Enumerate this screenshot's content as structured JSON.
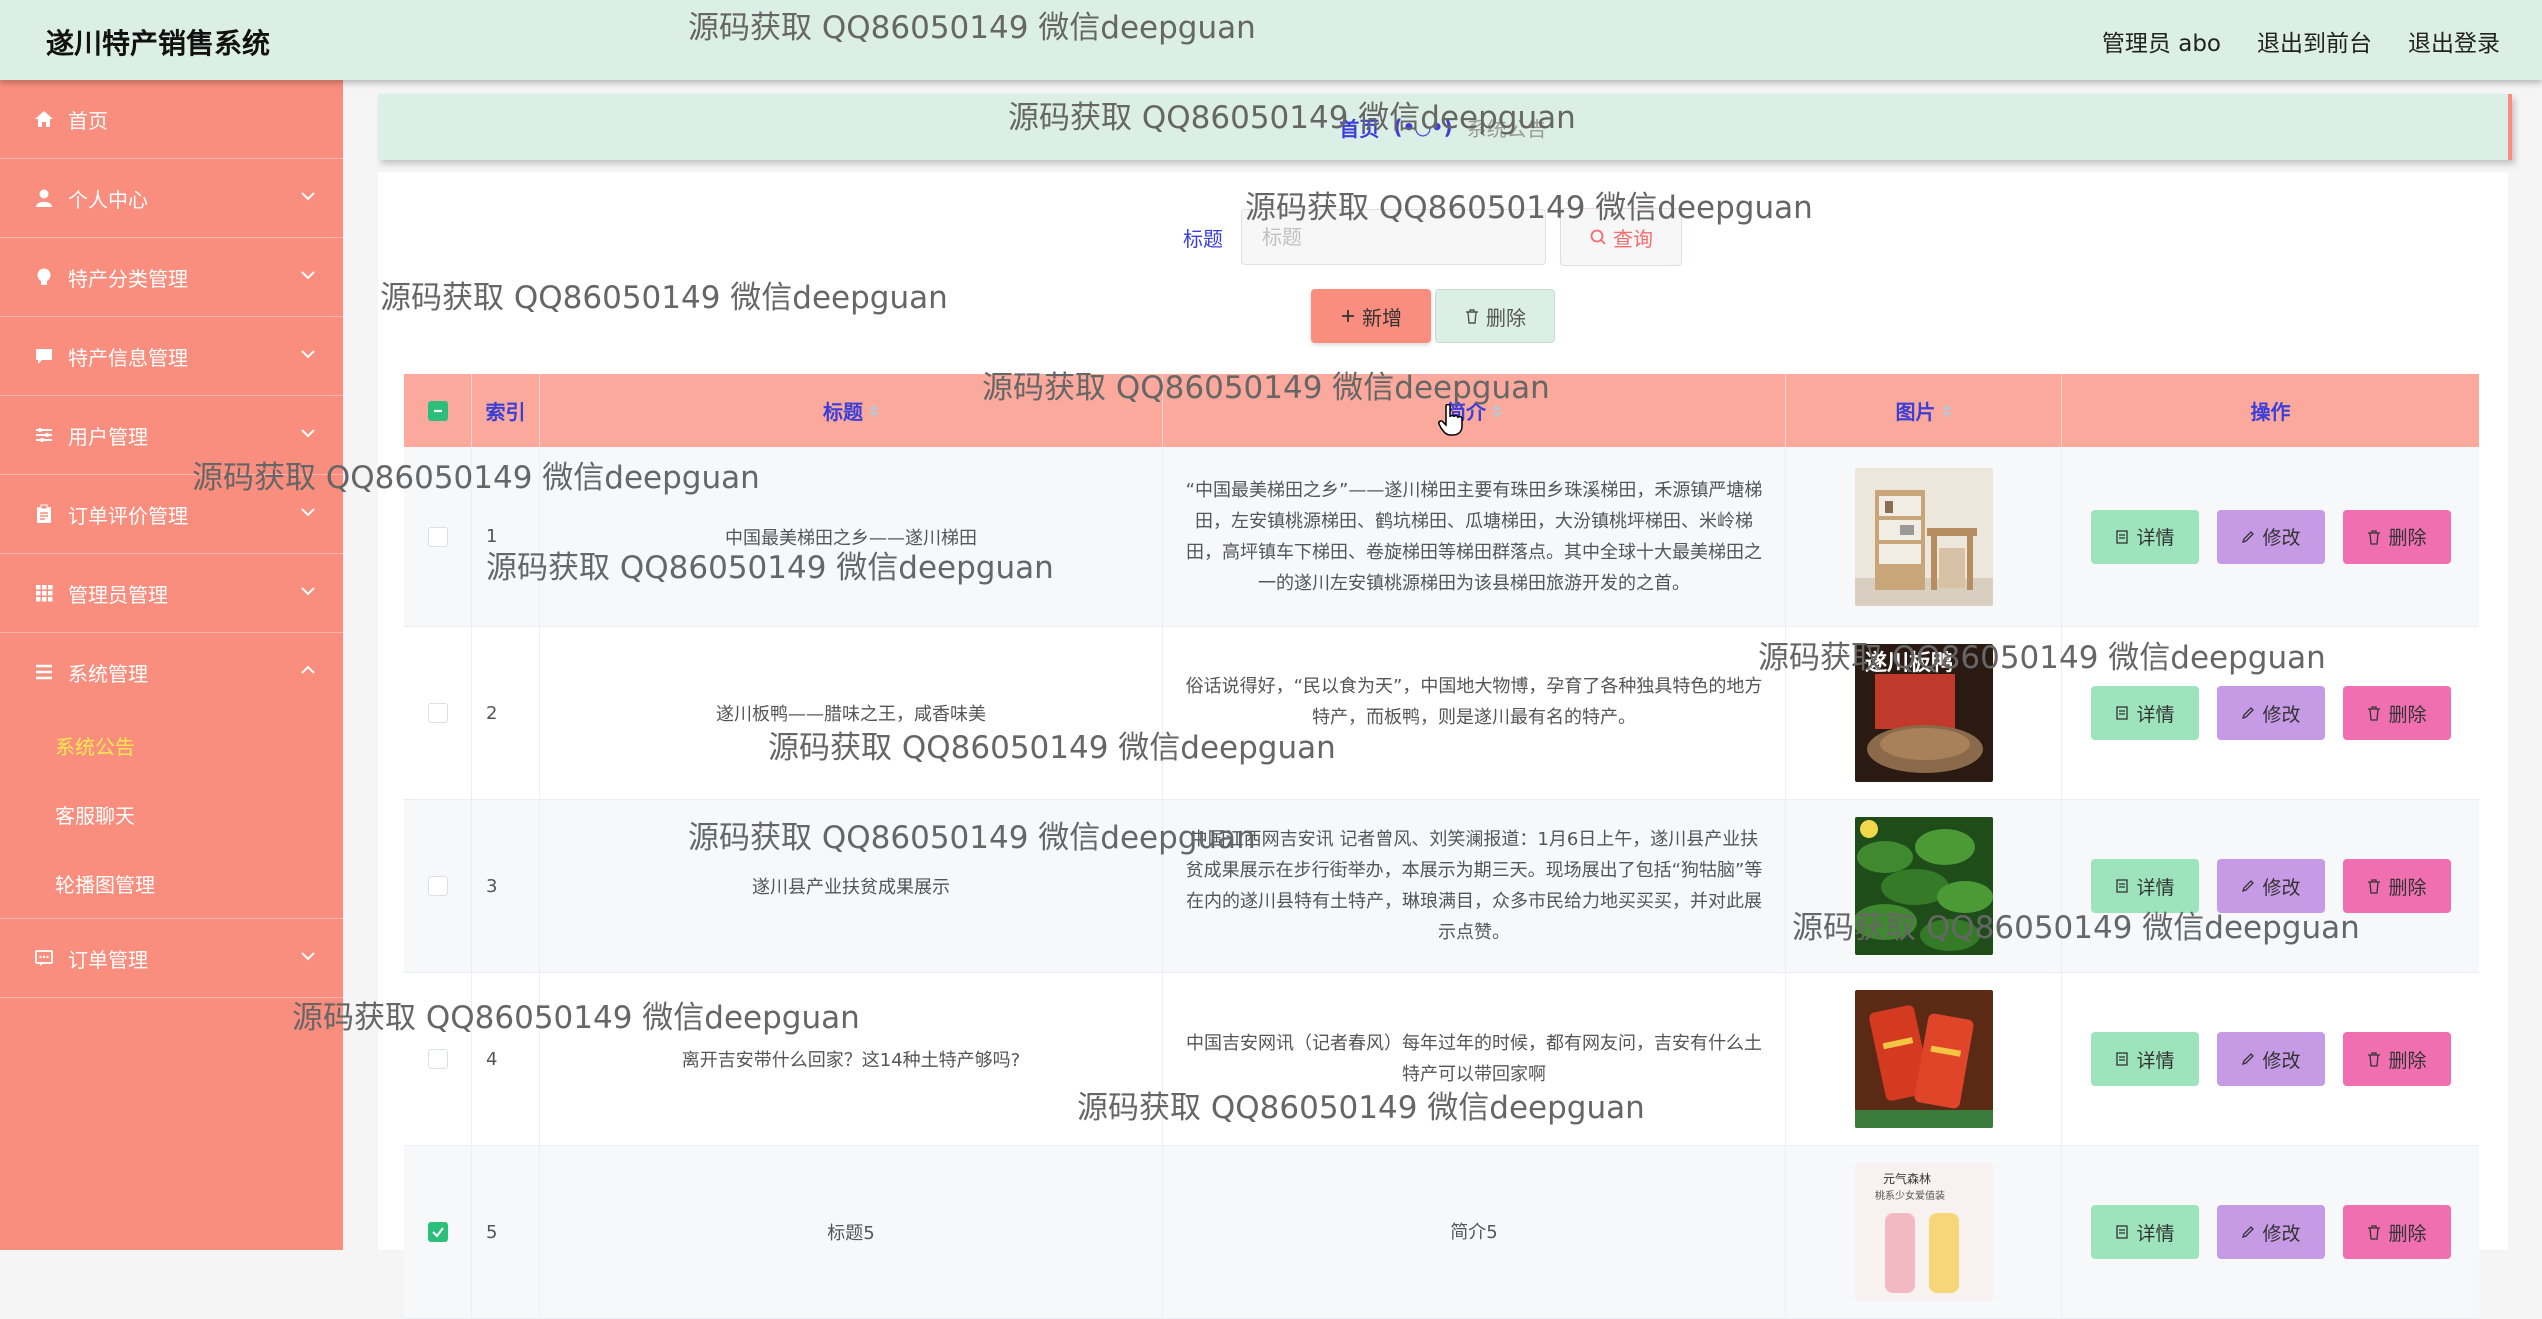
{
  "header": {
    "app_title": "遂川特产销售系统",
    "admin_label": "管理员 abo",
    "to_front_label": "退出到前台",
    "logout_label": "退出登录"
  },
  "sidebar": {
    "items": [
      {
        "label": "首页",
        "icon": "home-icon",
        "expandable": false
      },
      {
        "label": "个人中心",
        "icon": "user-icon",
        "expandable": true
      },
      {
        "label": "特产分类管理",
        "icon": "bulb-icon",
        "expandable": true
      },
      {
        "label": "特产信息管理",
        "icon": "chat-icon",
        "expandable": true
      },
      {
        "label": "用户管理",
        "icon": "sliders-icon",
        "expandable": true
      },
      {
        "label": "订单评价管理",
        "icon": "clipboard-icon",
        "expandable": true
      },
      {
        "label": "管理员管理",
        "icon": "grid-icon",
        "expandable": true
      },
      {
        "label": "系统管理",
        "icon": "menu-icon",
        "expandable": true,
        "expanded": true
      }
    ],
    "subitems": [
      {
        "label": "系统公告",
        "active": true
      },
      {
        "label": "客服聊天",
        "active": false
      },
      {
        "label": "轮播图管理",
        "active": false
      }
    ],
    "last_item": {
      "label": "订单管理",
      "icon": "message-icon"
    }
  },
  "breadcrumb": {
    "home": "首页",
    "face": "(•◡•)",
    "current": "系统公告"
  },
  "search": {
    "label": "标题",
    "placeholder": "标题",
    "button_label": "查询"
  },
  "actions": {
    "add_label": "新增",
    "delete_label": "删除"
  },
  "table": {
    "columns": {
      "index": "索引",
      "title": "标题",
      "brief": "简介",
      "image": "图片",
      "ops": "操作"
    },
    "op_labels": {
      "detail": "详情",
      "edit": "修改",
      "remove": "删除"
    },
    "rows": [
      {
        "index": "1",
        "title": "中国最美梯田之乡——遂川梯田",
        "brief": "“中国最美梯田之乡”——遂川梯田主要有珠田乡珠溪梯田，禾源镇严塘梯田，左安镇桃源梯田、鹤坑梯田、瓜塘梯田，大汾镇桃坪梯田、米岭梯田，高坪镇车下梯田、卷旋梯田等梯田群落点。其中全球十大最美梯田之一的遂川左安镇桃源梯田为该县梯田旅游开发的之首。",
        "image": "furniture-photo",
        "checked": false
      },
      {
        "index": "2",
        "title": "遂川板鸭——腊味之王，咸香味美",
        "brief": "俗话说得好，“民以食为天”，中国地大物博，孕育了各种独具特色的地方特产，而板鸭，则是遂川最有名的特产。",
        "image": "duck-photo",
        "image_text": "遂川板鸭",
        "checked": false
      },
      {
        "index": "3",
        "title": "遂川县产业扶贫成果展示",
        "brief": "中国江西网吉安讯 记者曾风、刘笑澜报道：1月6日上午，遂川县产业扶贫成果展示在步行街举办，本展示为期三天。现场展出了包括“狗牯脑”等在内的遂川县特有土特产，琳琅满目，众多市民给力地买买买，并对此展示点赞。",
        "image": "leaves-photo",
        "checked": false
      },
      {
        "index": "4",
        "title": "离开吉安带什么回家？这14种土特产够吗?",
        "brief": "中国吉安网讯（记者春风）每年过年的时候，都有网友问，吉安有什么土特产可以带回家啊",
        "image": "gift-photo",
        "checked": false
      },
      {
        "index": "5",
        "title": "标题5",
        "brief": "简介5",
        "image": "drink-photo",
        "image_text": "元气森林",
        "image_subtext": "桃系少女爱值装",
        "checked": true
      }
    ]
  },
  "watermark_text": "源码获取 QQ86050149 微信deepguan",
  "colors": {
    "header_bg": "#dcefe6",
    "sidebar_bg": "#fa8e7e",
    "table_head_bg": "#fba99c",
    "accent_blue": "#3b3fd8",
    "detail_btn": "#9de4bd",
    "edit_btn": "#c79ae6",
    "remove_btn": "#ef6fb1",
    "active_submenu": "#ffe84d"
  }
}
